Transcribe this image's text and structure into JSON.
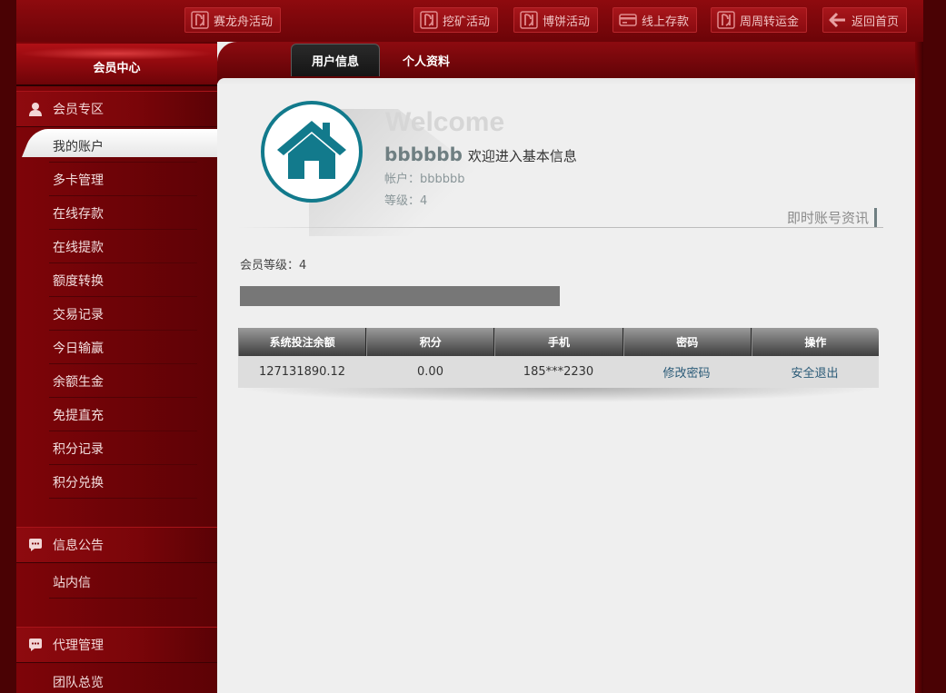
{
  "top_nav": [
    {
      "label": "赛龙舟活动",
      "icon": "brand-logo-icon"
    },
    {
      "label": "挖矿活动",
      "icon": "brand-logo-icon"
    },
    {
      "label": "博饼活动",
      "icon": "brand-logo-icon"
    },
    {
      "label": "线上存款",
      "icon": "credit-card-icon"
    },
    {
      "label": "周周转运金",
      "icon": "brand-logo-icon"
    },
    {
      "label": "返回首页",
      "icon": "arrow-left-icon"
    }
  ],
  "sidebar": {
    "title": "会员中心",
    "sections": [
      {
        "title": "会员专区",
        "icon": "user-icon",
        "items": [
          "我的账户",
          "多卡管理",
          "在线存款",
          "在线提款",
          "额度转换",
          "交易记录",
          "今日输赢",
          "余额生金",
          "免提直充",
          "积分记录",
          "积分兑换"
        ]
      },
      {
        "title": "信息公告",
        "icon": "chat-bubble-icon",
        "items": [
          "站内信"
        ]
      },
      {
        "title": "代理管理",
        "icon": "chat-bubble-icon",
        "items": [
          "团队总览"
        ]
      }
    ],
    "active_item": "我的账户"
  },
  "tabs": [
    {
      "label": "用户信息",
      "active": true
    },
    {
      "label": "个人资料",
      "active": false
    }
  ],
  "welcome": {
    "heading": "Welcome",
    "username": "bbbbbb",
    "subtitle": "欢迎进入基本信息",
    "account_label": "帐户：",
    "account_value": "bbbbbb",
    "level_label": "等级：",
    "level_value": "4",
    "realtime_label": "即时账号资讯"
  },
  "member_level": {
    "label": "会员等级：",
    "value": "4",
    "progress": 0
  },
  "table": {
    "headers": [
      "系统投注余额",
      "积分",
      "手机",
      "密码",
      "操作"
    ],
    "row": {
      "balance": "127131890.12",
      "points": "0.00",
      "phone": "185***2230",
      "password_action": "修改密码",
      "operation_action": "安全退出"
    }
  },
  "colors": {
    "brand_red": "#8e0a0e",
    "teal": "#127a8c",
    "content_bg": "#efefef"
  }
}
